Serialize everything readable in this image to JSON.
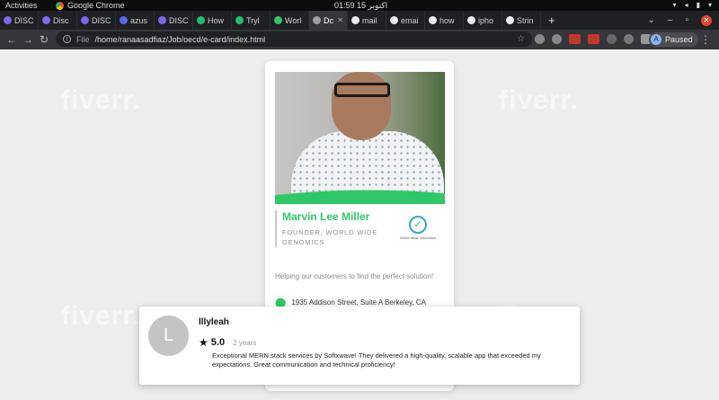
{
  "system": {
    "activities": "Activities",
    "app_name": "Google Chrome",
    "clock": "01:59 اکتوبر 15"
  },
  "browser": {
    "tabs": [
      {
        "label": "DISC",
        "color": "#7b68ee"
      },
      {
        "label": "Disc",
        "color": "#7b68ee"
      },
      {
        "label": "DISC",
        "color": "#7b68ee"
      },
      {
        "label": "azus",
        "color": "#5865f2"
      },
      {
        "label": "DISC",
        "color": "#7b68ee"
      },
      {
        "label": "How",
        "color": "#1dbf73"
      },
      {
        "label": "Tryl",
        "color": "#1dbf73"
      },
      {
        "label": "Worl",
        "color": "#2ec866"
      },
      {
        "label": "Dc",
        "color": "#9aa0a6"
      },
      {
        "label": "mail",
        "color": "#e8eaed"
      },
      {
        "label": "emai",
        "color": "#e8eaed"
      },
      {
        "label": "how",
        "color": "#e8eaed"
      },
      {
        "label": "ipho",
        "color": "#e8eaed"
      },
      {
        "label": "Strin",
        "color": "#e8eaed"
      }
    ],
    "address": {
      "scheme": "File",
      "url": "/home/ranaasadfiaz/Job/oecd/e-card/index.html"
    },
    "profile_label": "Paused",
    "profile_initial": "A"
  },
  "card": {
    "name": "Marvin Lee Miller",
    "role": "FOUNDER, WORLD WIDE GENOMICS",
    "logo_text": "World Wide Genomics",
    "tagline": "Helping our customers to find the perfect solution!",
    "address": "1935 Addison Street, Suite A Berkeley, CA 94704"
  },
  "watermark": "fiverr.",
  "review": {
    "initial": "L",
    "user": "lllyleah",
    "score": "5.0",
    "ago": "2 years",
    "text": "Exceptional MERN stack services by Softxwave! They delivered a high-quality, scalable app that exceeded my expectations. Great communication and technical proficiency!"
  },
  "colors": {
    "accent": "#2ec866",
    "logo_ring": "#31a9c8"
  }
}
